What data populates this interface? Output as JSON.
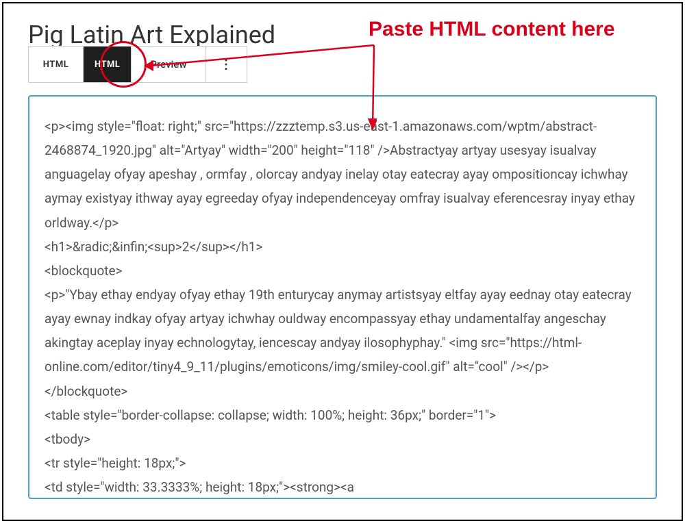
{
  "title": "Pig Latin Art Explained",
  "toolbar": {
    "html_view": "HTML",
    "html_active": "HTML",
    "preview": "Preview",
    "more": "⋮"
  },
  "annotation": {
    "text": "Paste HTML content here"
  },
  "editor_content": "<p><img style=\"float: right;\" src=\"https://zzztemp.s3.us-east-1.amazonaws.com/wptm/abstract-2468874_1920.jpg\" alt=\"Artyay\" width=\"200\" height=\"118\" />Abstractyay artyay usesyay isualvay anguagelay ofyay apeshay , ormfay , olorcay andyay inelay otay eatecray ayay ompositioncay ichwhay aymay existyay ithway ayay egreeday ofyay independenceyay omfray isualvay eferencesray inyay ethay orldway.</p>\n<h1>&radic;&infin;<sup>2</sup></h1>\n<blockquote>\n<p>\"Ybay ethay endyay ofyay ethay 19th enturycay anymay artistsyay eltfay ayay eednay otay eatecray ayay ewnay indkay ofyay artyay ichwhay ouldway encompassyay ethay undamentalfay angeschay akingtay aceplay inyay echnologytay, iencescay andyay ilosophyphay.\" <img src=\"https://html-online.com/editor/tiny4_9_11/plugins/emoticons/img/smiley-cool.gif\" alt=\"cool\" /></p>\n</blockquote>\n<table style=\"border-collapse: collapse; width: 100%; height: 36px;\" border=\"1\">\n<tbody>\n<tr style=\"height: 18px;\">\n<td style=\"width: 33.3333%; height: 18px;\"><strong><a"
}
